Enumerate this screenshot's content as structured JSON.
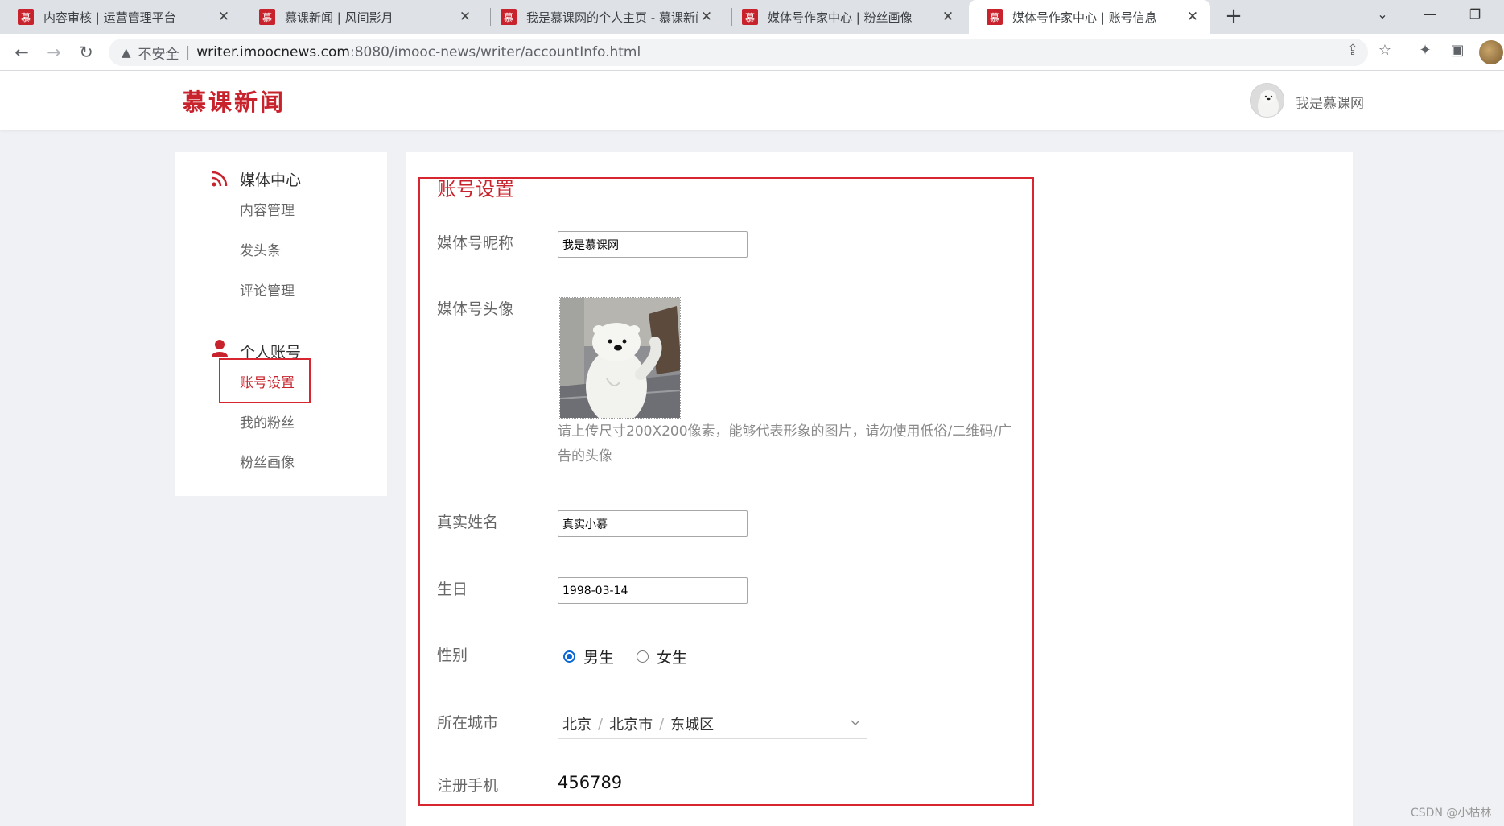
{
  "browser": {
    "tabs": [
      {
        "favicon": "慕",
        "title": "内容审核 | 运营管理平台",
        "active": false
      },
      {
        "favicon": "慕",
        "title": "慕课新闻 | 风间影月",
        "active": false
      },
      {
        "favicon": "慕",
        "title": "我是慕课网的个人主页 - 慕课新闻",
        "active": false
      },
      {
        "favicon": "慕",
        "title": "媒体号作家中心 | 粉丝画像",
        "active": false
      },
      {
        "favicon": "慕",
        "title": "媒体号作家中心 | 账号信息",
        "active": true
      }
    ],
    "address": {
      "security_label": "不安全",
      "host": "writer.imoocnews.com",
      "rest": ":8080/imooc-news/writer/accountInfo.html"
    }
  },
  "header": {
    "logo": "慕课新闻",
    "username": "我是慕课网"
  },
  "sidebar": {
    "groups": [
      {
        "title": "媒体中心",
        "icon": "rss-icon",
        "items": [
          "内容管理",
          "发头条",
          "评论管理"
        ]
      },
      {
        "title": "个人账号",
        "icon": "user-icon",
        "items": [
          "账号设置",
          "我的粉丝",
          "粉丝画像"
        ]
      }
    ],
    "active_item": "账号设置"
  },
  "form": {
    "section_title": "账号设置",
    "nickname": {
      "label": "媒体号昵称",
      "value": "我是慕课网"
    },
    "avatar": {
      "label": "媒体号头像",
      "hint": "请上传尺寸200X200像素，能够代表形象的图片，请勿使用低俗/二维码/广告的头像"
    },
    "real_name": {
      "label": "真实姓名",
      "value": "真实小慕"
    },
    "birthday": {
      "label": "生日",
      "value": "1998-03-14"
    },
    "gender": {
      "label": "性别",
      "options": [
        "男生",
        "女生"
      ],
      "selected": "男生"
    },
    "city": {
      "label": "所在城市",
      "province": "北京",
      "city": "北京市",
      "district": "东城区"
    },
    "phone": {
      "label": "注册手机",
      "value": "456789"
    }
  },
  "watermark": "CSDN @小枯林",
  "colors": {
    "brand": "#c8232c",
    "highlight_border": "#d7262f",
    "radio_checked": "#0a66d6"
  }
}
